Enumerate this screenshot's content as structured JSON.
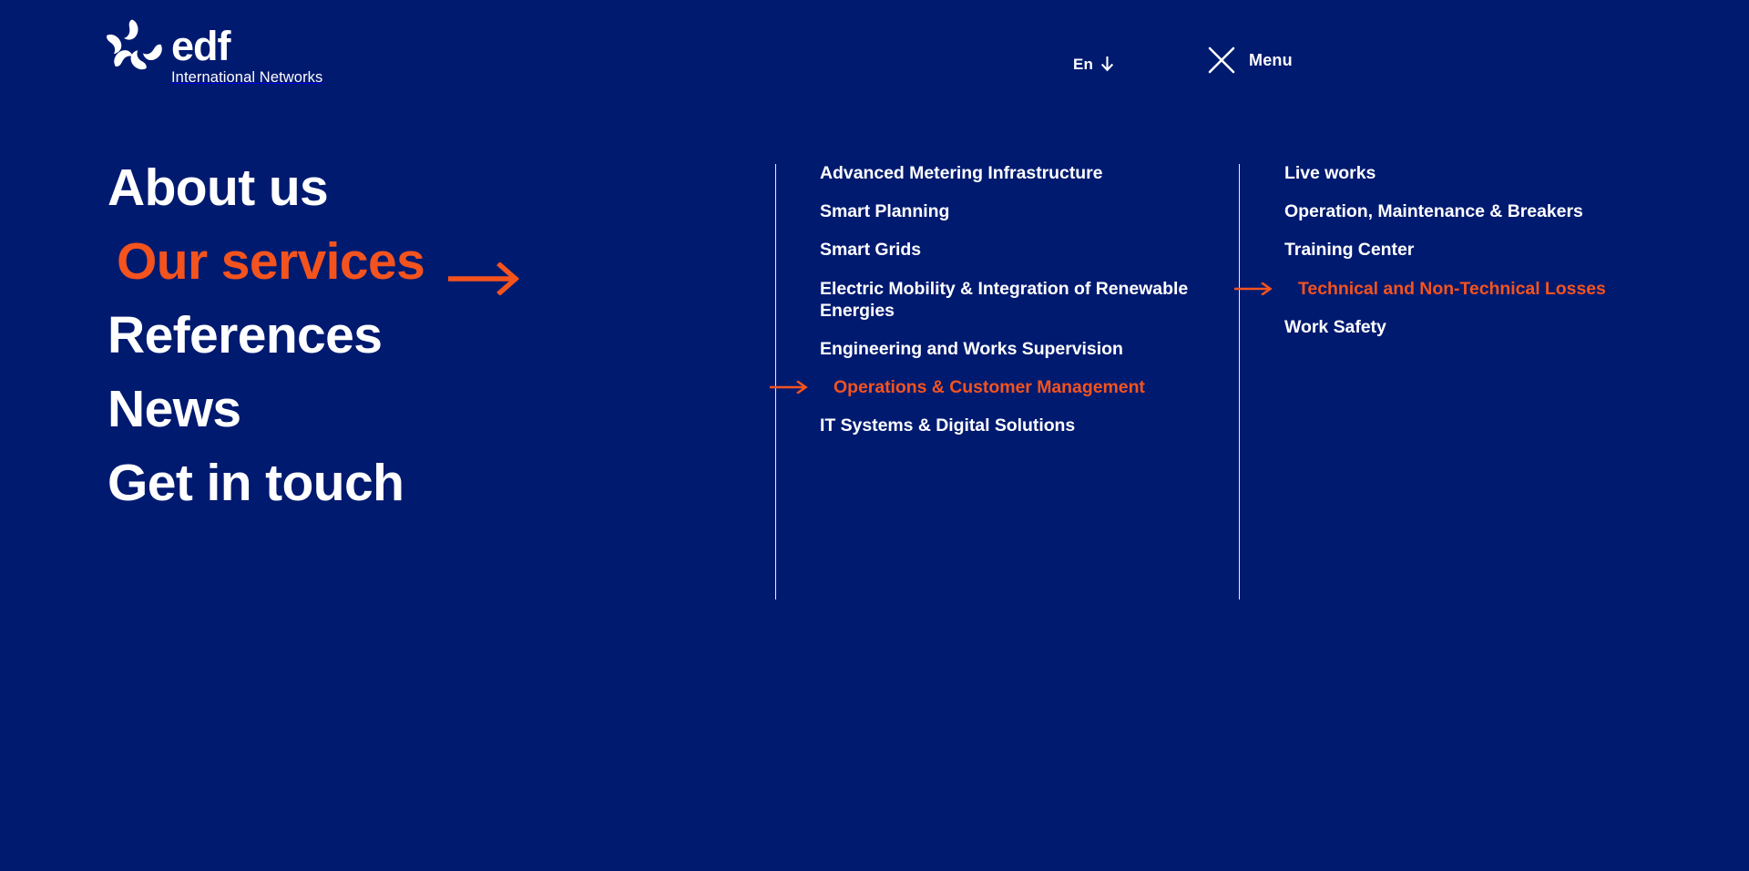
{
  "theme": {
    "background": "#001A70",
    "text": "#FFFFFF",
    "accent": "#F4531E"
  },
  "header": {
    "brand": {
      "name": "edf",
      "tagline": "International Networks",
      "logo_icon": "edf-pinwheel-logo"
    },
    "language": {
      "label": "En",
      "icon": "arrow-down-icon"
    },
    "menu": {
      "label": "Menu",
      "icon": "close-x-icon",
      "state": "open"
    }
  },
  "nav": {
    "primary": [
      {
        "label": "About us",
        "active": false
      },
      {
        "label": "Our services",
        "active": true
      },
      {
        "label": "References",
        "active": false
      },
      {
        "label": "News",
        "active": false
      },
      {
        "label": "Get in touch",
        "active": false
      }
    ],
    "secondary": [
      {
        "label": "Advanced Metering Infrastructure",
        "active": false
      },
      {
        "label": "Smart Planning",
        "active": false
      },
      {
        "label": "Smart Grids",
        "active": false
      },
      {
        "label": "Electric Mobility & Integration of Renewable Energies",
        "active": false
      },
      {
        "label": "Engineering and Works Supervision",
        "active": false
      },
      {
        "label": "Operations & Customer Management",
        "active": true
      },
      {
        "label": "IT Systems & Digital Solutions",
        "active": false
      }
    ],
    "tertiary": [
      {
        "label": "Live works",
        "active": false
      },
      {
        "label": "Operation, Maintenance & Breakers",
        "active": false
      },
      {
        "label": "Training Center",
        "active": false
      },
      {
        "label": "Technical and Non-Technical Losses",
        "active": true
      },
      {
        "label": "Work Safety",
        "active": false
      }
    ]
  }
}
